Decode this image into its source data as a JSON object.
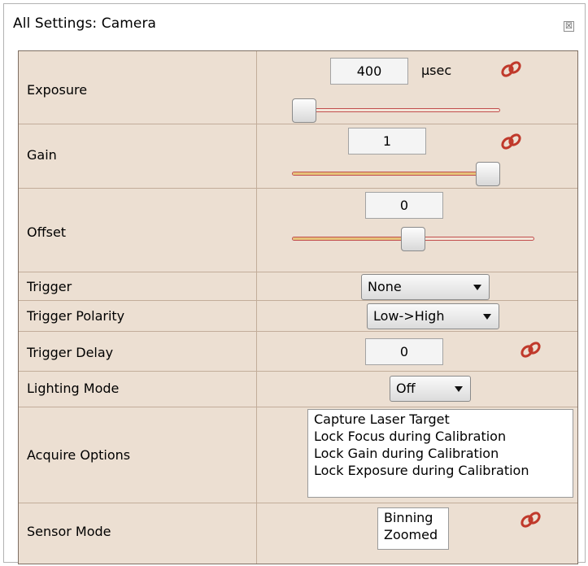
{
  "window": {
    "title": "All Settings: Camera",
    "close_glyph": "☒"
  },
  "exposure": {
    "label": "Exposure",
    "value": "400",
    "unit": "μsec",
    "slider_fraction": 0.0,
    "link_icon": "chain-link-icon"
  },
  "gain": {
    "label": "Gain",
    "value": "1",
    "slider_fraction": 1.0,
    "link_icon": "chain-link-icon"
  },
  "offset": {
    "label": "Offset",
    "value": "0",
    "slider_fraction": 0.5
  },
  "trigger": {
    "label": "Trigger",
    "selected": "None"
  },
  "trigger_polarity": {
    "label": "Trigger Polarity",
    "selected": "Low->High"
  },
  "trigger_delay": {
    "label": "Trigger Delay",
    "value": "0",
    "link_icon": "chain-link-icon"
  },
  "lighting_mode": {
    "label": "Lighting Mode",
    "selected": "Off"
  },
  "acquire_options": {
    "label": "Acquire Options",
    "items": [
      "Capture Laser Target",
      "Lock Focus during Calibration",
      "Lock Gain during Calibration",
      "Lock Exposure during Calibration"
    ]
  },
  "sensor_mode": {
    "label": "Sensor Mode",
    "items": [
      "Binning",
      "Zoomed"
    ],
    "link_icon": "chain-link-icon"
  },
  "colors": {
    "panel": "#ecdfd2",
    "grid_line": "#c2ad9a",
    "slider_track": "#c24e4e",
    "slider_fill": "#e6c37a",
    "link_icon": "#c0392b"
  }
}
